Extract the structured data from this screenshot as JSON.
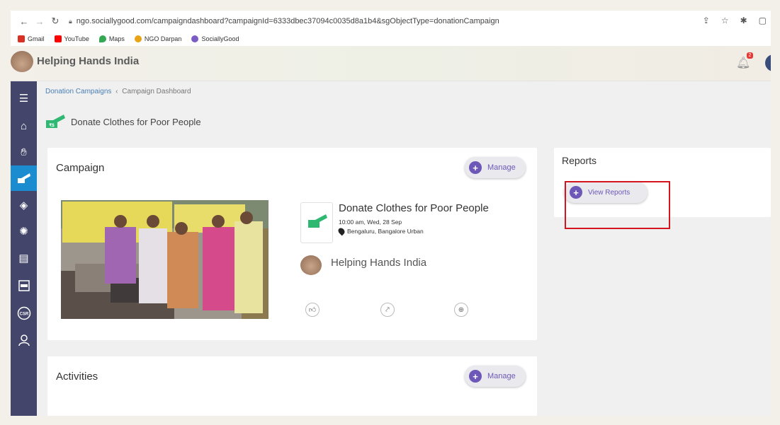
{
  "browser": {
    "url": "ngo.sociallygood.com/campaigndashboard?campaignId=6333dbec37094c0035d8a1b4&sgObjectType=donationCampaign",
    "bookmarks": [
      {
        "label": "Gmail",
        "color": "#d93025"
      },
      {
        "label": "YouTube",
        "color": "#ff0000"
      },
      {
        "label": "Maps",
        "color": "#34a853"
      },
      {
        "label": "NGO Darpan",
        "color": "#e8a317"
      },
      {
        "label": "SociallyGood",
        "color": "#7b5cc4"
      }
    ]
  },
  "header": {
    "org_title": "Helping Hands India",
    "notification_count": "2"
  },
  "breadcrumb": {
    "parent": "Donation Campaigns",
    "separator": "‹",
    "current": "Campaign Dashboard"
  },
  "page": {
    "title": "Donate Clothes for Poor People"
  },
  "campaign_card": {
    "heading": "Campaign",
    "manage_label": "Manage",
    "title": "Donate Clothes for Poor People",
    "datetime": "10:00 am, Wed, 28 Sep",
    "location": "Bengaluru, Bangalore Urban",
    "org_name": "Helping Hands India"
  },
  "activities_card": {
    "heading": "Activities",
    "manage_label": "Manage"
  },
  "reports_card": {
    "heading": "Reports",
    "view_label": "View Reports"
  },
  "colors": {
    "sidebar": "#43456a",
    "sidebar_active": "#1b8cd0",
    "accent": "#6d58b8",
    "highlight": "#d4151d"
  }
}
